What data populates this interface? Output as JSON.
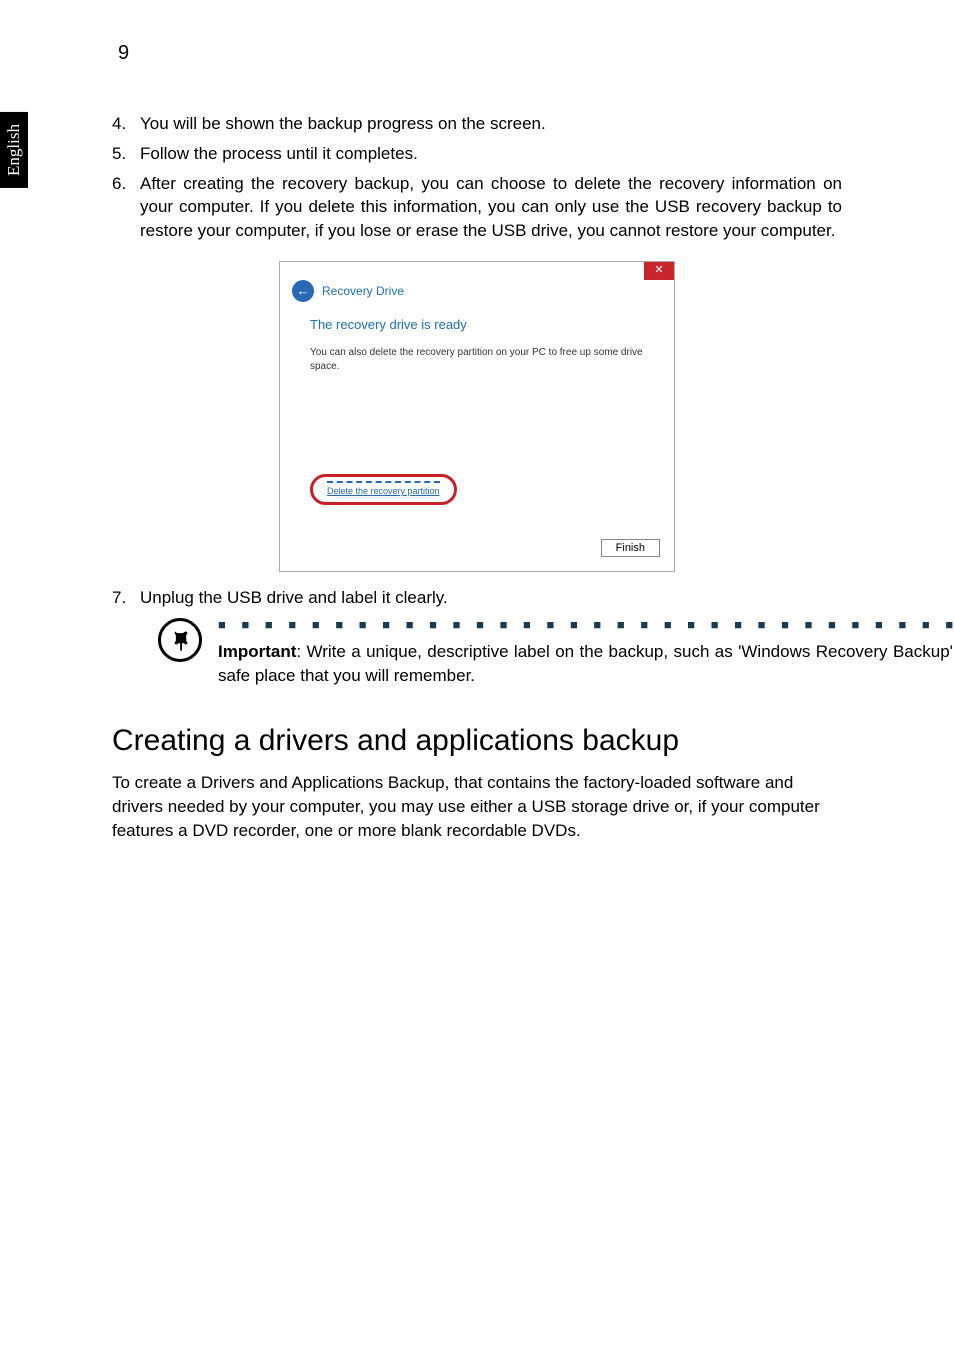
{
  "page_number": "9",
  "language_tab": "English",
  "steps": {
    "s4_num": "4.",
    "s4_text": "You will be shown the backup progress on the screen.",
    "s5_num": "5.",
    "s5_text": "Follow the process until it completes.",
    "s6_num": "6.",
    "s6_text": "After creating the recovery backup, you can choose to delete the recovery information on your computer. If you delete this information, you can only use the USB recovery backup to restore your computer, if you lose or erase the USB drive, you cannot restore your computer.",
    "s7_num": "7.",
    "s7_text": "Unplug the USB drive and label it clearly."
  },
  "dialog": {
    "back_glyph": "←",
    "close_glyph": "✕",
    "title_label": "Recovery Drive",
    "heading": "The recovery drive is ready",
    "body_text": "You can also delete the recovery partition on your PC to free up some drive space.",
    "delete_link": "Delete the recovery partition",
    "finish_button": "Finish"
  },
  "important": {
    "label": "Important",
    "text": ": Write a unique, descriptive label on the backup, such as 'Windows Recovery Backup'. Make sure you keep the backup in a safe place that you will remember."
  },
  "section_heading": "Creating a drivers and applications backup",
  "section_para": "To create a Drivers and Applications Backup, that contains the factory-loaded software and drivers needed by your computer, you may use either a USB storage drive or, if your computer features a DVD recorder, one or more blank recordable DVDs."
}
